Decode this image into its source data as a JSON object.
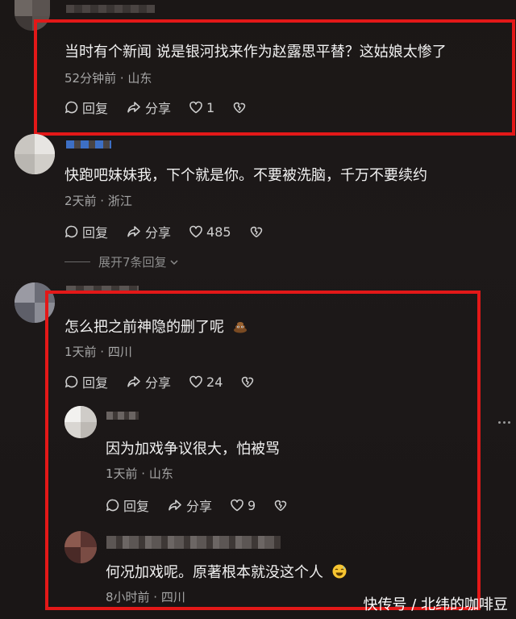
{
  "comments": [
    {
      "text": "当时有个新闻 说是银河找来作为赵露思平替？这姑娘太惨了",
      "meta": "52分钟前 · 山东",
      "reply": "回复",
      "share": "分享",
      "likes": "1"
    },
    {
      "text": "快跑吧妹妹我，下个就是你。不要被洗脑，千万不要续约",
      "meta": "2天前 · 浙江",
      "reply": "回复",
      "share": "分享",
      "likes": "485",
      "expand": "展开7条回复"
    },
    {
      "text": "怎么把之前神隐的删了呢",
      "meta": "1天前 · 四川",
      "reply": "回复",
      "share": "分享",
      "likes": "24",
      "emoji": "poop-emoji"
    }
  ],
  "replies": [
    {
      "text": "因为加戏争议很大，怕被骂",
      "meta": "1天前 · 山东",
      "reply": "回复",
      "share": "分享",
      "likes": "9"
    },
    {
      "text": "何况加戏呢。原著根本就没这个人",
      "meta": "8小时前 · 四川",
      "emoji": "sweat-smile-emoji"
    }
  ],
  "more_icon": "ellipsis-icon",
  "watermark": "快传号 / 北纬的咖啡豆",
  "colors": {
    "highlight_box": "#e31818",
    "background": "#1b1716",
    "meta_text": "#a6a6a6"
  }
}
